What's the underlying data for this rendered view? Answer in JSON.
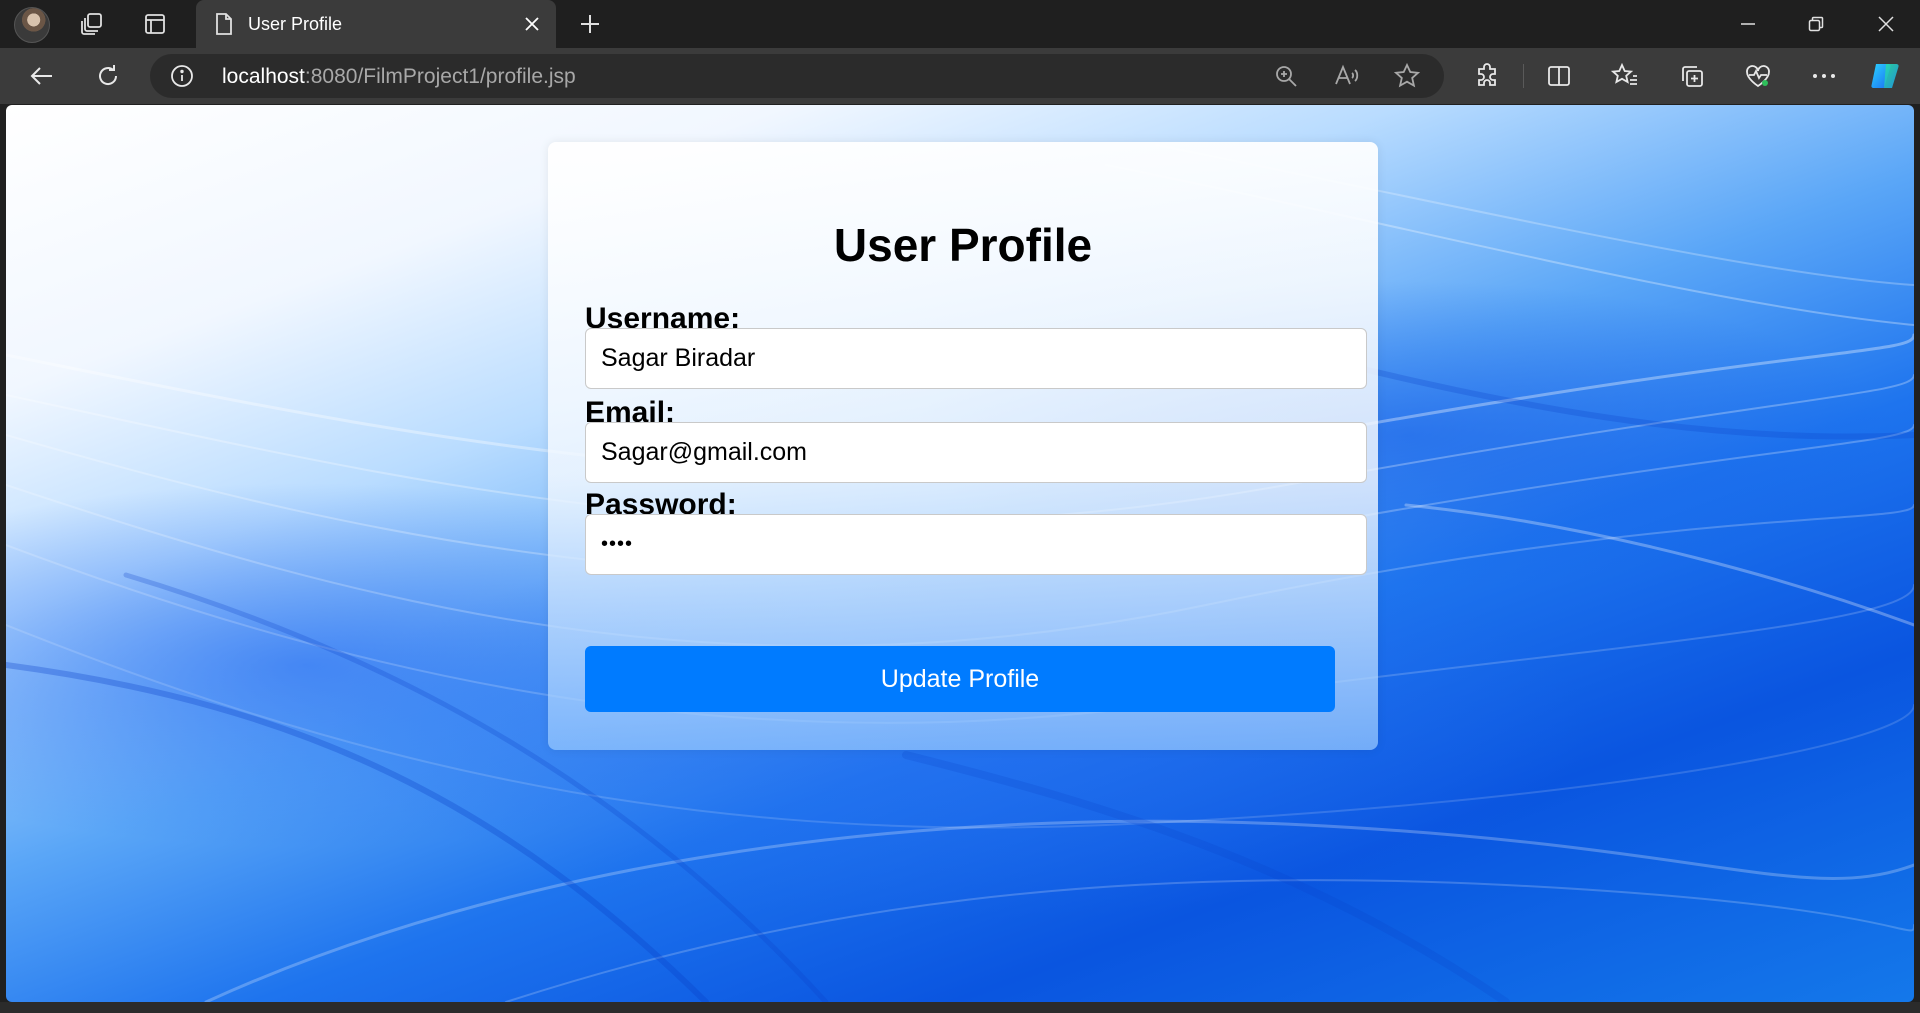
{
  "browser": {
    "tab_title": "User Profile",
    "url_host": "localhost",
    "url_rest": ":8080/FilmProject1/profile.jsp"
  },
  "page": {
    "heading": "User Profile",
    "username_label": "Username:",
    "username_value": "Sagar Biradar",
    "email_label": "Email:",
    "email_value": "Sagar@gmail.com",
    "password_label": "Password:",
    "password_value": "••••",
    "update_button": "Update Profile"
  },
  "colors": {
    "button": "#007bff",
    "tab_active": "#3b3b3b",
    "tabstrip": "#1f1f1f"
  },
  "icons": [
    "profile-avatar",
    "workspaces-icon",
    "tab-actions-icon",
    "page-icon",
    "close-icon",
    "plus-icon",
    "minimize-icon",
    "restore-icon",
    "close-window-icon",
    "back-icon",
    "refresh-icon",
    "info-icon",
    "zoom-icon",
    "read-aloud-icon",
    "favorite-star-icon",
    "extensions-icon",
    "split-screen-icon",
    "favorites-icon",
    "collections-icon",
    "browser-essentials-icon",
    "more-icon",
    "copilot-icon"
  ]
}
